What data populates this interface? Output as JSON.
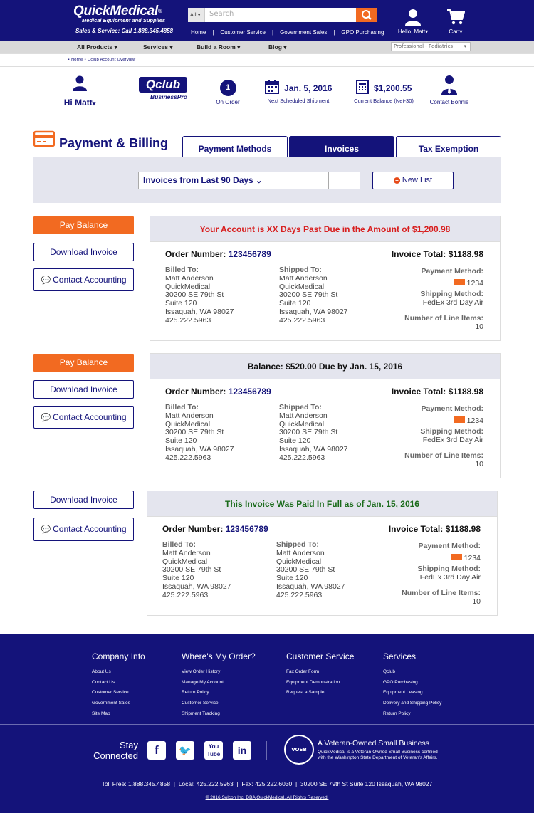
{
  "header": {
    "brand": "QuickMedical",
    "brand_mark": "®",
    "tagline": "Medical Equipment and Supplies",
    "sales_line": "Sales & Service: Call 1.888.345.4858",
    "search_scope": "All",
    "search_placeholder": "Search",
    "links": [
      "Home",
      "Customer Service",
      "Government Sales",
      "GPO Purchasing"
    ],
    "user_greeting": "Hello, Matt",
    "cart_label": "Cart"
  },
  "nav": {
    "items": [
      "All Products",
      "Services",
      "Build a Room",
      "Blog"
    ],
    "practice_select": "Professional - Pediatrics"
  },
  "breadcrumb": "• Home • Qclub Account Overview",
  "qclub": {
    "greeting": "Hi Matt",
    "logo_main": "Qclub",
    "logo_sub": "BusinessPro",
    "order_count": "1",
    "order_label": "On Order",
    "shipment_date": "Jan. 5, 2016",
    "shipment_label": "Next Scheduled Shipment",
    "balance": "$1,200.55",
    "balance_label": "Current Balance (Net-30)",
    "contact_label": "Contact Bonnie"
  },
  "page": {
    "title": "Payment & Billing",
    "tabs": [
      "Payment Methods",
      "Invoices",
      "Tax Exemption"
    ],
    "active_tab": "Invoices",
    "filter": "Invoices from Last 90 Days",
    "new_list": "New List"
  },
  "actions": {
    "pay": "Pay Balance",
    "download": "Download Invoice",
    "contact": "Contact Accounting"
  },
  "invoices": [
    {
      "status": "Your Account is XX Days Past Due in the Amount of $1,200.98",
      "status_color": "#d81e1e",
      "order_label": "Order Number:",
      "order_number": "123456789",
      "total": "Invoice Total: $1188.98",
      "billed_label": "Billed To:",
      "billed": [
        "Matt Anderson",
        "QuickMedical",
        "30200 SE 79th St",
        "Suite 120",
        "Issaquah, WA 98027",
        "425.222.5963"
      ],
      "shipped_label": "Shipped To:",
      "shipped": [
        "Matt Anderson",
        "QuickMedical",
        "30200 SE 79th St",
        "Suite 120",
        "Issaquah, WA 98027",
        "425.222.5963"
      ],
      "payment_label": "Payment Method:",
      "card_last4": "1234",
      "shipping_label": "Shipping Method:",
      "shipping": "FedEx 3rd Day Air",
      "items_label": "Number of Line Items:",
      "items": "10"
    },
    {
      "status": "Balance: $520.00 Due by Jan. 15, 2016",
      "status_color": "#111111",
      "order_label": "Order Number:",
      "order_number": "123456789",
      "total": "Invoice Total: $1188.98",
      "billed_label": "Billed To:",
      "billed": [
        "Matt Anderson",
        "QuickMedical",
        "30200 SE 79th St",
        "Suite 120",
        "Issaquah, WA 98027",
        "425.222.5963"
      ],
      "shipped_label": "Shipped To:",
      "shipped": [
        "Matt Anderson",
        "QuickMedical",
        "30200 SE 79th St",
        "Suite 120",
        "Issaquah, WA 98027",
        "425.222.5963"
      ],
      "payment_label": "Payment Method:",
      "card_last4": "1234",
      "shipping_label": "Shipping Method:",
      "shipping": "FedEx 3rd Day Air",
      "items_label": "Number of Line Items:",
      "items": "10"
    },
    {
      "status": "This Invoice Was Paid In Full as of Jan. 15, 2016",
      "status_color": "#1a6b1a",
      "order_label": "Order Number:",
      "order_number": "123456789",
      "total": "Invoice Total: $1188.98",
      "billed_label": "Billed To:",
      "billed": [
        "Matt Anderson",
        "QuickMedical",
        "30200 SE 79th St",
        "Suite 120",
        "Issaquah, WA 98027",
        "425.222.5963"
      ],
      "shipped_label": "Shipped To:",
      "shipped": [
        "Matt Anderson",
        "QuickMedical",
        "30200 SE 79th St",
        "Suite 120",
        "Issaquah, WA 98027",
        "425.222.5963"
      ],
      "payment_label": "Payment Method:",
      "card_last4": "1234",
      "shipping_label": "Shipping Method:",
      "shipping": "FedEx 3rd Day Air",
      "items_label": "Number of Line Items:",
      "items": "10"
    }
  ],
  "footer": {
    "columns": [
      {
        "title": "Company Info",
        "links": [
          "About Us",
          "Contact Us",
          "Customer Service",
          "Government Sales",
          "Site Map"
        ]
      },
      {
        "title": "Where's My Order?",
        "links": [
          "View Order History",
          "Manage My Account",
          "Return Policy",
          "Customer Service",
          "Shipment Tracking"
        ]
      },
      {
        "title": "Customer Service",
        "links": [
          "Fax Order Form",
          "Equipment Demonstration",
          "Request a Sample"
        ]
      },
      {
        "title": "Services",
        "links": [
          "Qclub",
          "GPO Purchasing",
          "Equipment Leasing",
          "Delivery and Shipping Policy",
          "Return Policy"
        ]
      }
    ],
    "stay_line1": "Stay",
    "stay_line2": "Connected",
    "vosb_badge": "VOSB",
    "vosb_title": "A Veteran-Owned Small Business",
    "vosb_desc": "QuickMedical is a Veteran-Owned Small Business certified with the Washington State Department of Veteran's Affairs.",
    "contact_line": "Toll Free: 1.888.345.4858  |  Local: 425.222.5963  |  Fax: 425.222.6030  |  30200 SE 79th St Suite 120 Issaquah, WA 98027",
    "copyright": "© 2016 Solcon Inc. DBA QuickMedical. All Rights Reserved."
  },
  "colors": {
    "brand": "#14137a",
    "accent": "#f26a21",
    "panel": "#e4e5ee"
  }
}
